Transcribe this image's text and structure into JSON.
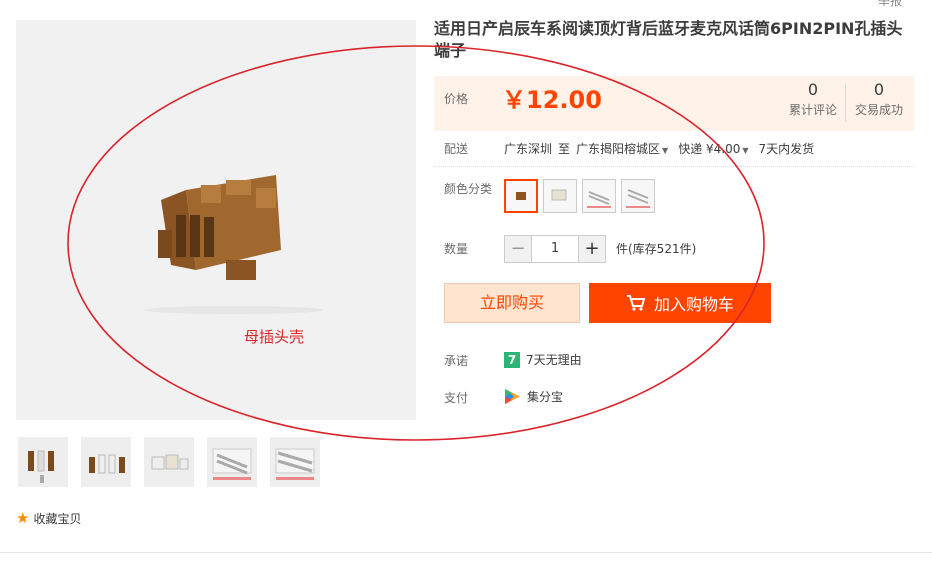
{
  "report_link": "举报",
  "main_image": {
    "caption": "母插头壳"
  },
  "thumbnails_count": 5,
  "favorite": {
    "icon": "star-icon",
    "label": "收藏宝贝"
  },
  "product": {
    "title": "适用日产启辰车系阅读顶灯背后蓝牙麦克风话筒6PIN2PIN孔插头端子"
  },
  "price": {
    "label": "价格",
    "value": "￥12.00",
    "reviews_count": "0",
    "reviews_label": "累计评论",
    "sales_count": "0",
    "sales_label": "交易成功"
  },
  "delivery": {
    "label": "配送",
    "from": "广东深圳",
    "to_word": "至",
    "to": "广东揭阳榕城区",
    "express": "快递 ¥4.00",
    "ship_time": "7天内发货"
  },
  "color": {
    "label": "颜色分类"
  },
  "quantity": {
    "label": "数量",
    "minus": "−",
    "value": "1",
    "plus": "+",
    "stock": "件(库存521件)"
  },
  "buttons": {
    "buy_now": "立即购买",
    "add_cart": "加入购物车"
  },
  "promise": {
    "label": "承诺",
    "badge": "7",
    "text": "7天无理由"
  },
  "payment": {
    "label": "支付",
    "text": "集分宝"
  },
  "colors": {
    "accent": "#ff4400",
    "annotation": "#d9252b"
  }
}
